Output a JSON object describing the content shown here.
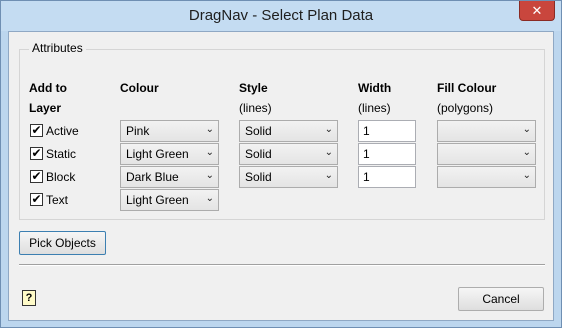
{
  "window": {
    "title": "DragNav - Select Plan Data",
    "close_glyph": "✕"
  },
  "attributes": {
    "group_label": "Attributes",
    "headers": {
      "add_to": "Add to",
      "layer": "Layer",
      "colour": "Colour",
      "style": "Style",
      "style_sub": "(lines)",
      "width": "Width",
      "width_sub": "(lines)",
      "fill_colour": "Fill Colour",
      "fill_sub": "(polygons)"
    },
    "rows": [
      {
        "checked": true,
        "check_glyph": "✔",
        "label": "Active",
        "colour": "Pink",
        "style": "Solid",
        "width": "1",
        "fill": ""
      },
      {
        "checked": true,
        "check_glyph": "✔",
        "label": "Static",
        "colour": "Light Green",
        "style": "Solid",
        "width": "1",
        "fill": ""
      },
      {
        "checked": true,
        "check_glyph": "✔",
        "label": "Block",
        "colour": "Dark Blue",
        "style": "Solid",
        "width": "1",
        "fill": ""
      },
      {
        "checked": true,
        "check_glyph": "✔",
        "label": "Text",
        "colour": "Light Green"
      }
    ],
    "dropdown_arrow": "⌄"
  },
  "buttons": {
    "pick_objects": "Pick Objects",
    "cancel": "Cancel"
  },
  "help": {
    "icon": "help-icon",
    "glyph": "?"
  }
}
